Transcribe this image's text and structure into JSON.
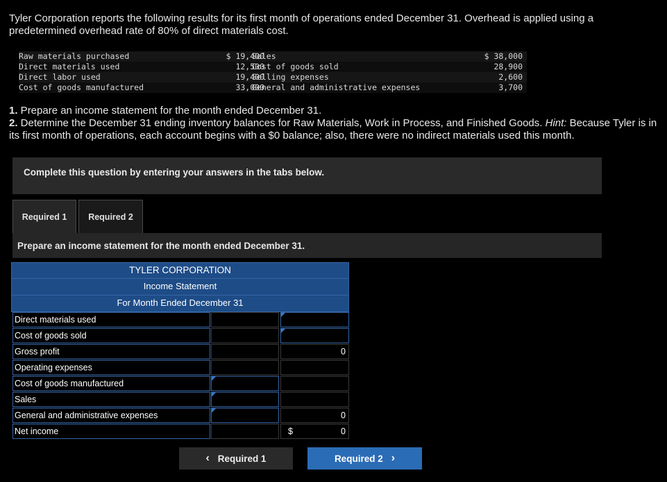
{
  "intro": "Tyler Corporation reports the following results for its first month of operations ended December 31. Overhead is applied using a predetermined overhead rate of 80% of direct materials cost.",
  "data_table": [
    {
      "label1": "Raw materials purchased",
      "value1": "$ 19,400",
      "label2": "Sales",
      "value2": "$ 38,000"
    },
    {
      "label1": "Direct materials used",
      "value1": "12,500",
      "label2": "Cost of goods sold",
      "value2": "28,900"
    },
    {
      "label1": "Direct labor used",
      "value1": "19,400",
      "label2": "Selling expenses",
      "value2": "2,600"
    },
    {
      "label1": "Cost of goods manufactured",
      "value1": "33,000",
      "label2": "General and administrative expenses",
      "value2": "3,700"
    }
  ],
  "instructions": {
    "item1_num": "1.",
    "item1_text": " Prepare an income statement for the month ended December 31.",
    "item2_num": "2.",
    "item2_text": " Determine the December 31 ending inventory balances for Raw Materials, Work in Process, and Finished Goods. ",
    "item2_hint": "Hint:",
    "item2_rest": " Because Tyler is in its first month of operations, each account begins with a $0 balance; also, there were no indirect materials used this month."
  },
  "banner": "Complete this question by entering your answers in the tabs below.",
  "tabs": [
    {
      "label": "Required 1"
    },
    {
      "label": "Required 2"
    }
  ],
  "panel_prompt": "Prepare an income statement for the month ended December 31.",
  "statement": {
    "company": "TYLER CORPORATION",
    "title": "Income Statement",
    "period": "For Month Ended December 31",
    "rows": [
      {
        "label": "Direct materials used",
        "col1": "",
        "col2": "",
        "dollar": ""
      },
      {
        "label": "Cost of goods sold",
        "col1": "",
        "col2": "",
        "dollar": ""
      },
      {
        "label": "Gross profit",
        "col1": "",
        "col2": "0",
        "dollar": ""
      },
      {
        "label": "Operating expenses",
        "col1": "",
        "col2": "",
        "dollar": ""
      },
      {
        "label": "Cost of goods manufactured",
        "col1": "",
        "col2": "",
        "dollar": ""
      },
      {
        "label": "Sales",
        "col1": "",
        "col2": "",
        "dollar": ""
      },
      {
        "label": "General and administrative expenses",
        "col1": "",
        "col2": "0",
        "dollar": ""
      },
      {
        "label": "Net income",
        "col1": "",
        "col2": "0",
        "dollar": "$"
      }
    ]
  },
  "nav": {
    "prev_label": "Required 1",
    "next_label": "Required 2",
    "prev_icon": "chevron-left-icon",
    "next_icon": "chevron-right-icon"
  }
}
